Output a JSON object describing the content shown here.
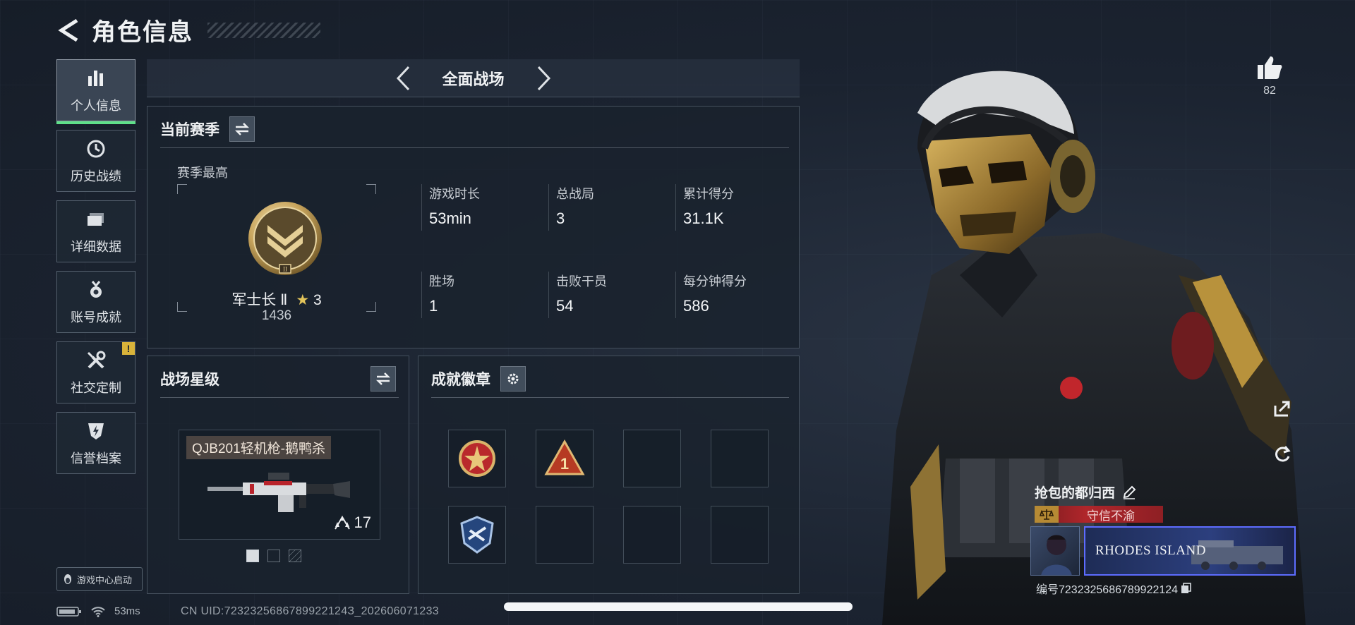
{
  "header": {
    "title": "角色信息"
  },
  "sidebar": {
    "items": [
      {
        "label": "个人信息",
        "icon": "bar-chart-icon",
        "active": true
      },
      {
        "label": "历史战绩",
        "icon": "clock-icon"
      },
      {
        "label": "详细数据",
        "icon": "folder-icon"
      },
      {
        "label": "账号成就",
        "icon": "medal-icon"
      },
      {
        "label": "社交定制",
        "icon": "tools-icon",
        "badge": "!"
      },
      {
        "label": "信誉档案",
        "icon": "lightning-shield-icon"
      }
    ],
    "launch_label": "游戏中心启动"
  },
  "mode": {
    "label": "全面战场"
  },
  "season": {
    "title": "当前赛季",
    "best_label": "赛季最高",
    "rank_name": "军士长 Ⅱ",
    "rank_stars": "3",
    "rank_score": "1436",
    "stats": [
      {
        "label": "游戏时长",
        "value": "53min"
      },
      {
        "label": "总战局",
        "value": "3"
      },
      {
        "label": "累计得分",
        "value": "31.1K"
      },
      {
        "label": "胜场",
        "value": "1"
      },
      {
        "label": "击败干员",
        "value": "54"
      },
      {
        "label": "每分钟得分",
        "value": "586"
      }
    ]
  },
  "star_level": {
    "title": "战场星级",
    "weapon_name": "QJB201轻机枪-鹅鸭杀",
    "weapon_stars": "17",
    "page_index": 0,
    "page_count": 3
  },
  "badges": {
    "title": "成就徽章"
  },
  "player": {
    "likes": "82",
    "name": "抢包的都归西",
    "reputation": "守信不渝",
    "banner_text": "RHODES ISLAND",
    "id_text": "编号7232325686789922124"
  },
  "status": {
    "ping": "53ms",
    "uid": "CN UID:7232325686789922124З_202606071233"
  },
  "colors": {
    "accent_green": "#5fe08a",
    "badge_yellow": "#d9b33a",
    "reputation_red": "#b0262b",
    "banner_blue": "#5d6cff"
  }
}
